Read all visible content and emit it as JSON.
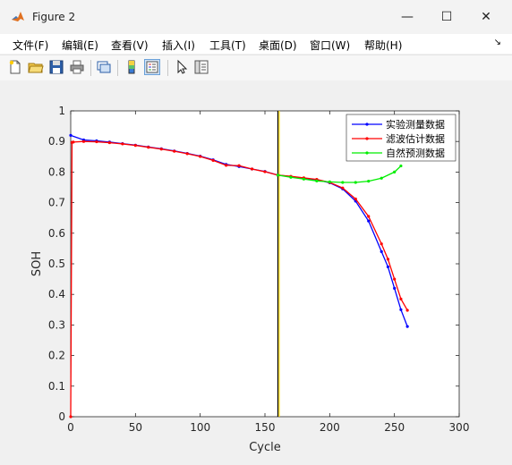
{
  "window": {
    "title": "Figure 2",
    "minimize_glyph": "—",
    "maximize_glyph": "☐",
    "close_glyph": "✕"
  },
  "menu": [
    "文件(F)",
    "编辑(E)",
    "查看(V)",
    "插入(I)",
    "工具(T)",
    "桌面(D)",
    "窗口(W)",
    "帮助(H)"
  ],
  "menu_overflow_glyph": "↘",
  "toolbar": [
    "new-figure-icon",
    "open-file-icon",
    "save-icon",
    "print-icon",
    "link-plot-icon",
    "colorbar-icon",
    "legend-icon",
    "pointer-icon",
    "property-editor-icon"
  ],
  "chart_data": {
    "type": "line",
    "xlabel": "Cycle",
    "ylabel": "SOH",
    "xlim": [
      0,
      300
    ],
    "ylim": [
      0,
      1
    ],
    "xticks": [
      0,
      50,
      100,
      150,
      200,
      250,
      300
    ],
    "yticks": [
      0,
      0.1,
      0.2,
      0.3,
      0.4,
      0.5,
      0.6,
      0.7,
      0.8,
      0.9,
      1
    ],
    "legend_position": "top-right",
    "vertical_lines": [
      {
        "x": 160,
        "color": "#000000"
      },
      {
        "x": 161,
        "color": "#ffd700"
      }
    ],
    "series": [
      {
        "name": "实验测量数据",
        "color": "#0000ff",
        "x": [
          0,
          10,
          20,
          30,
          40,
          50,
          60,
          70,
          80,
          90,
          100,
          110,
          120,
          130,
          140,
          150,
          160,
          170,
          180,
          190,
          200,
          210,
          220,
          230,
          240,
          245,
          250,
          255,
          260
        ],
        "y": [
          0.92,
          0.905,
          0.902,
          0.898,
          0.893,
          0.888,
          0.882,
          0.876,
          0.869,
          0.861,
          0.852,
          0.84,
          0.825,
          0.818,
          0.81,
          0.802,
          0.79,
          0.785,
          0.78,
          0.775,
          0.765,
          0.745,
          0.705,
          0.64,
          0.54,
          0.49,
          0.42,
          0.35,
          0.295
        ]
      },
      {
        "name": "滤波估计数据",
        "color": "#ff0000",
        "x": [
          0,
          1,
          2,
          10,
          20,
          30,
          40,
          50,
          60,
          70,
          80,
          90,
          100,
          110,
          120,
          130,
          140,
          150,
          160,
          170,
          180,
          190,
          200,
          210,
          220,
          230,
          240,
          245,
          250,
          255,
          260
        ],
        "y": [
          0,
          0.897,
          0.898,
          0.9,
          0.899,
          0.896,
          0.892,
          0.887,
          0.881,
          0.875,
          0.868,
          0.86,
          0.851,
          0.838,
          0.822,
          0.821,
          0.81,
          0.801,
          0.79,
          0.786,
          0.781,
          0.776,
          0.766,
          0.748,
          0.712,
          0.655,
          0.565,
          0.515,
          0.45,
          0.385,
          0.348
        ]
      },
      {
        "name": "自然预测数据",
        "color": "#00ee00",
        "x": [
          160,
          170,
          180,
          190,
          200,
          210,
          220,
          230,
          240,
          250,
          255
        ],
        "y": [
          0.79,
          0.783,
          0.777,
          0.771,
          0.768,
          0.766,
          0.766,
          0.77,
          0.78,
          0.8,
          0.82
        ]
      }
    ]
  }
}
